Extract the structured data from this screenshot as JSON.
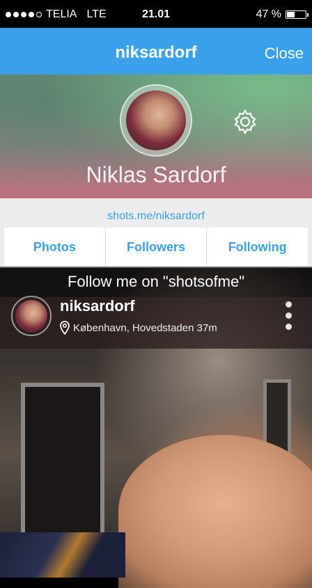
{
  "status": {
    "carrier": "TELIA",
    "network": "LTE",
    "time": "21.01",
    "battery_text": "47 %",
    "battery_level": 0.47,
    "signal_bars": 4
  },
  "nav": {
    "title": "niksardorf",
    "close_label": "Close"
  },
  "profile": {
    "display_name": "Niklas Sardorf"
  },
  "panel": {
    "link": "shots.me/niksardorf",
    "tabs": [
      "Photos",
      "Followers",
      "Following"
    ]
  },
  "caption": "Follow me on \"shotsofme\"",
  "card": {
    "username": "niksardorf",
    "location": "København, Hovedstaden 37m"
  }
}
